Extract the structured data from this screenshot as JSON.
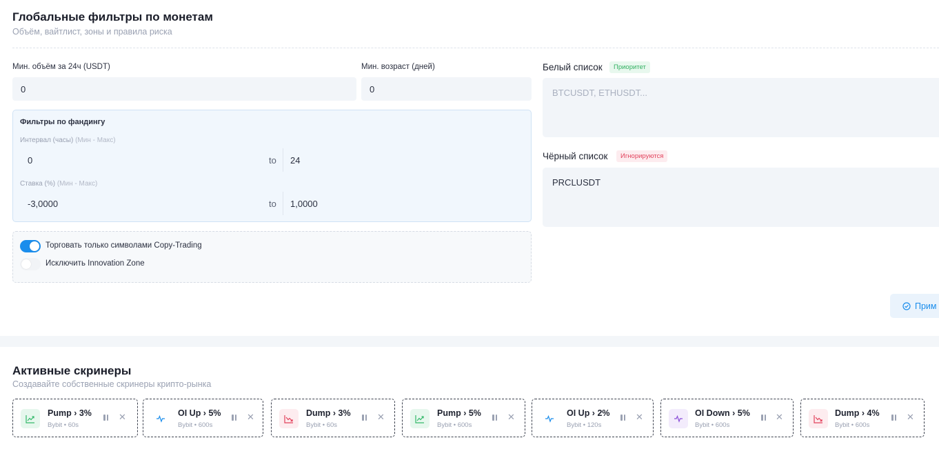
{
  "filters": {
    "title": "Глобальные фильтры по монетам",
    "subtitle": "Объём, вайтлист, зоны и правила риска",
    "min_volume_label": "Мин. объём за 24ч (USDT)",
    "min_volume_value": "0",
    "min_age_label": "Мин. возраст (дней)",
    "min_age_value": "0",
    "funding": {
      "title": "Фильтры по фандингу",
      "interval_label": "Интервал (часы)",
      "interval_hint": "(Мин - Макс)",
      "interval_min": "0",
      "interval_to": "to",
      "interval_max": "24",
      "rate_label": "Ставка (%)",
      "rate_hint": "(Мин - Макс)",
      "rate_min": "-3,0000",
      "rate_to": "to",
      "rate_max": "1,0000"
    },
    "toggles": {
      "copy_trading_label": "Торговать только символами Copy-Trading",
      "copy_trading_on": true,
      "innovation_label": "Исключить Innovation Zone",
      "innovation_on": false
    },
    "whitelist": {
      "title": "Белый список",
      "badge": "Приоритет",
      "placeholder": "BTCUSDT, ETHUSDT..."
    },
    "blacklist": {
      "title": "Чёрный список",
      "badge": "Игнорируются",
      "value": "PRCLUSDT"
    },
    "apply_label": "Прим"
  },
  "screeners": {
    "title": "Активные скринеры",
    "subtitle": "Создавайте собственные скринеры крипто-рынка",
    "cards": [
      {
        "title": "Pump › 3%",
        "sub": "Bybit • 60s",
        "icon": "trend-up-icon",
        "color": "#33b86a",
        "bg": "#e6f7ed"
      },
      {
        "title": "OI Up › 5%",
        "sub": "Bybit • 600s",
        "icon": "pulse-icon",
        "color": "#1a8dec",
        "bg": "#ffffff"
      },
      {
        "title": "Dump › 3%",
        "sub": "Bybit • 60s",
        "icon": "trend-down-icon",
        "color": "#e2415b",
        "bg": "#fdecef"
      },
      {
        "title": "Pump › 5%",
        "sub": "Bybit • 600s",
        "icon": "trend-up-icon",
        "color": "#33b86a",
        "bg": "#e6f7ed"
      },
      {
        "title": "OI Up › 2%",
        "sub": "Bybit • 120s",
        "icon": "pulse-icon",
        "color": "#1a8dec",
        "bg": "#ffffff"
      },
      {
        "title": "OI Down › 5%",
        "sub": "Bybit • 600s",
        "icon": "pulse-icon",
        "color": "#8b4fd8",
        "bg": "#f3ecfc"
      },
      {
        "title": "Dump › 4%",
        "sub": "Bybit • 600s",
        "icon": "trend-down-icon",
        "color": "#e2415b",
        "bg": "#fdecef"
      }
    ]
  }
}
